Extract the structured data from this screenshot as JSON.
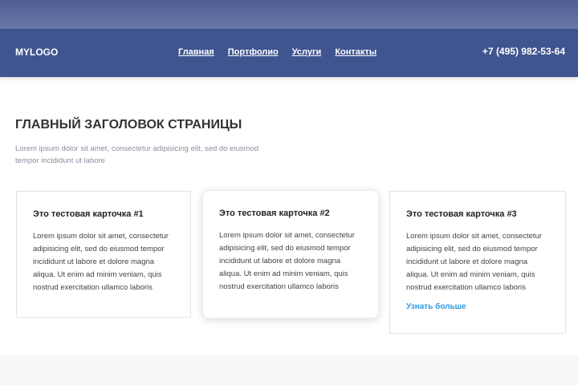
{
  "header": {
    "logo": "MYLOGO",
    "nav": [
      "Главная",
      "Портфолио",
      "Услуги",
      "Контакты"
    ],
    "phone": "+7 (495) 982-53-64"
  },
  "main": {
    "title": "ГЛАВНЫЙ ЗАГОЛОВОК СТРАНИЦЫ",
    "subtitle": "Lorem ipsum dolor sit amet, consectetur adipisicing elit, sed do eiusmod tempor incididunt ut labore",
    "cards": [
      {
        "title": "Это тестовая карточка #1",
        "text": "Lorem ipsum dolor sit amet, consectetur adipisicing elit, sed do eiusmod tempor incididunt ut labore et dolore magna aliqua. Ut enim ad minim veniam, quis nostrud exercitation ullamco laboris"
      },
      {
        "title": "Это тестовая карточка #2",
        "text": "Lorem ipsum dolor sit amet, consectetur adipisicing elit, sed do eiusmod tempor incididunt ut labore et dolore magna aliqua. Ut enim ad minim veniam, quis nostrud exercitation ullamco laboris"
      },
      {
        "title": "Это тестовая карточка #3",
        "text": "Lorem ipsum dolor sit amet, consectetur adipisicing elit, sed do eiusmod tempor incididunt ut labore et dolore magna aliqua. Ut enim ad minim veniam, quis nostrud exercitation ullamco laboris",
        "link": "Узнать больше"
      }
    ]
  }
}
